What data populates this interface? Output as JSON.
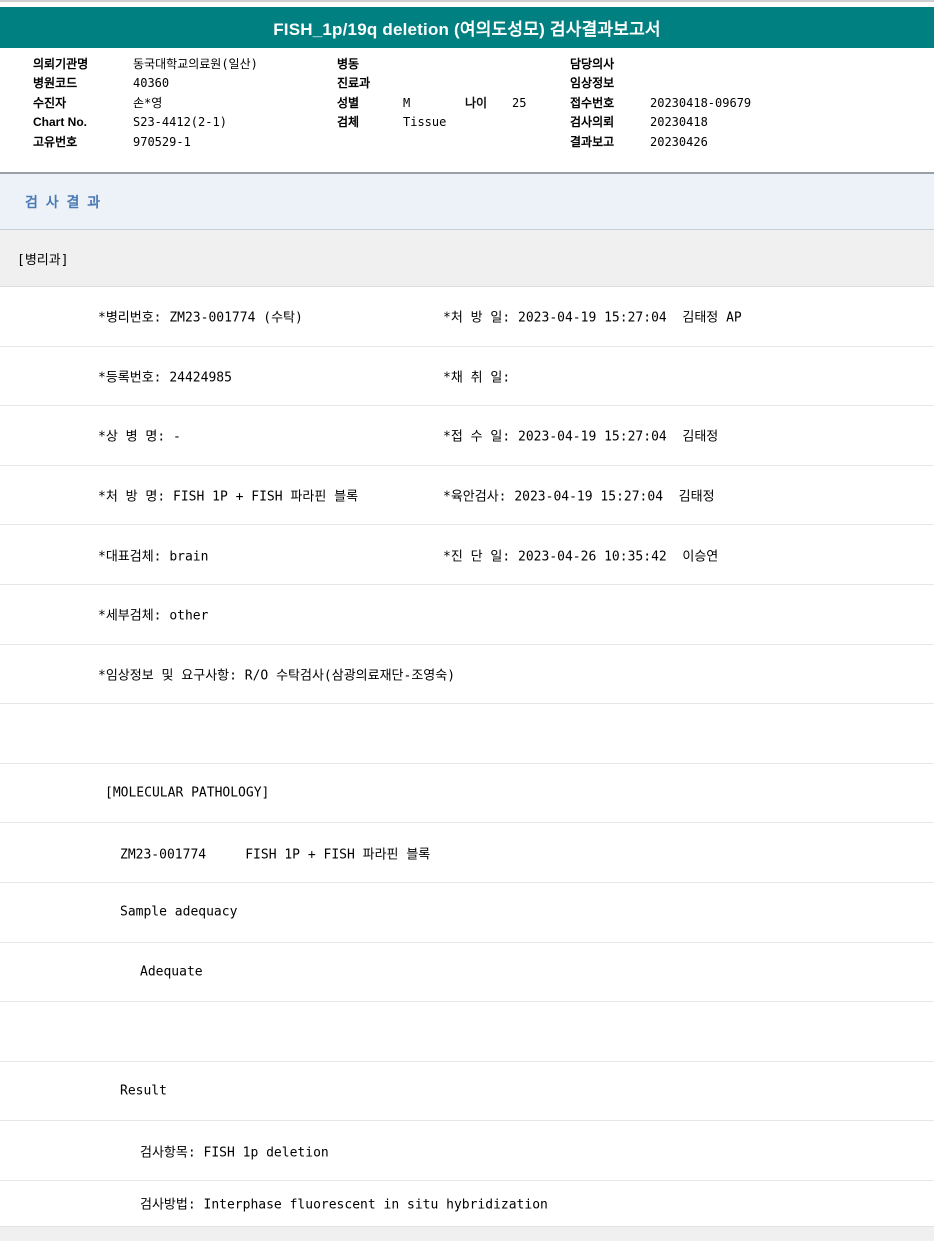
{
  "title": "FISH_1p/19q deletion (여의도성모) 검사결과보고서",
  "colors": {
    "banner_bg": "#008080",
    "banner_text": "#ffffff",
    "section_head_bg": "#edf2f9",
    "section_title_text": "#4a7ab5",
    "dept_band_bg": "#f0f0f0"
  },
  "info": {
    "left": [
      {
        "label": "의뢰기관명",
        "value": "동국대학교의료원(일산)"
      },
      {
        "label": "병원코드",
        "value": "40360"
      },
      {
        "label": "수진자",
        "value": "손*영"
      },
      {
        "label": "Chart No.",
        "value": "S23-4412(2-1)"
      },
      {
        "label": "고유번호",
        "value": "970529-1"
      }
    ],
    "mid": [
      {
        "label": "병동",
        "value": ""
      },
      {
        "label": "진료과",
        "value": ""
      },
      {
        "label": "성별",
        "value": "M"
      },
      {
        "label": "검체",
        "value": "Tissue"
      }
    ],
    "age": {
      "label": "나이",
      "value": "25"
    },
    "right": [
      {
        "label": "담당의사",
        "value": ""
      },
      {
        "label": "임상정보",
        "value": ""
      },
      {
        "label": "접수번호",
        "value": "20230418-09679"
      },
      {
        "label": "검사의뢰",
        "value": "20230418"
      },
      {
        "label": "결과보고",
        "value": "20230426"
      }
    ]
  },
  "report": {
    "section_title": "검 사 결 과",
    "department": "[병리과]",
    "rows": [
      {
        "left": "*병리번호: ZM23-001774 (수탁)",
        "right": "*처 방 일: 2023-04-19 15:27:04  김태정 AP"
      },
      {
        "left": "*등록번호: 24424985",
        "right": "*채 취 일:"
      },
      {
        "left": "*상 병 명: -",
        "right": "*접 수 일: 2023-04-19 15:27:04  김태정"
      },
      {
        "left": "*처 방 명: FISH 1P + FISH 파라핀 블록",
        "right": "*육안검사: 2023-04-19 15:27:04  김태정"
      },
      {
        "left": "*대표검체: brain",
        "right": "*진 단 일: 2023-04-26 10:35:42  이승연"
      },
      {
        "left": "*세부검체: other",
        "right": ""
      },
      {
        "left": "*임상정보 및 요구사항: R/O 수탁검사(삼광의료재단-조영숙)",
        "right": ""
      },
      {
        "left": "",
        "right": ""
      },
      {
        "left": "[MOLECULAR PATHOLOGY]",
        "right": ""
      },
      {
        "left": "ZM23-001774     FISH 1P + FISH 파라핀 블록",
        "right": ""
      },
      {
        "left": "Sample adequacy",
        "right": ""
      },
      {
        "left": "Adequate",
        "right": ""
      },
      {
        "left": "",
        "right": ""
      },
      {
        "left": "Result",
        "right": ""
      },
      {
        "left": "검사항목: FISH 1p deletion",
        "right": ""
      },
      {
        "left": "검사방법: Interphase fluorescent in situ hybridization",
        "right": ""
      }
    ]
  }
}
